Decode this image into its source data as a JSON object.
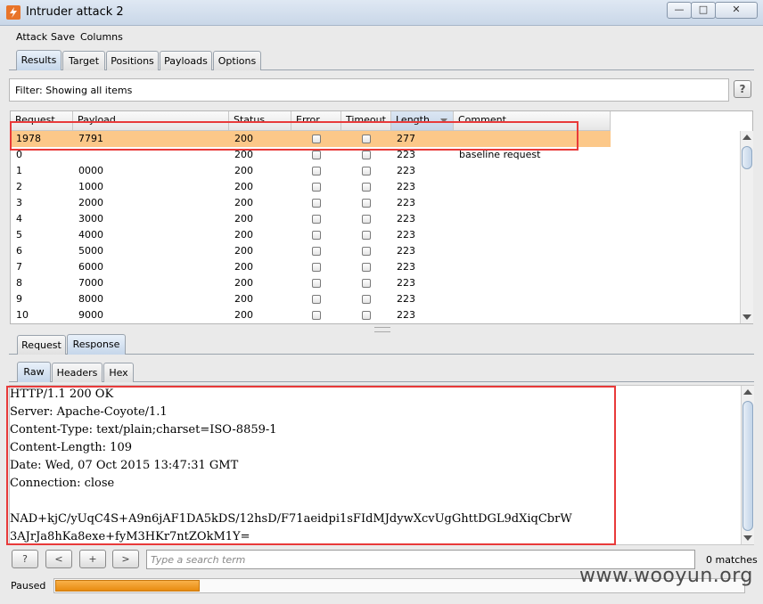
{
  "window": {
    "title": "Intruder attack 2",
    "min_label": "—",
    "max_label": "□",
    "close_label": "✕"
  },
  "menu": [
    "Attack",
    "Save",
    "Columns"
  ],
  "tabs": [
    "Results",
    "Target",
    "Positions",
    "Payloads",
    "Options"
  ],
  "active_tab": "Results",
  "filter": {
    "text": "Filter:  Showing all items",
    "help_label": "?"
  },
  "table": {
    "columns": [
      "Request",
      "Payload",
      "Status",
      "Error",
      "Timeout",
      "Length",
      "Comment"
    ],
    "sorted_column": "Length",
    "rows": [
      {
        "request": "1978",
        "payload": "7791",
        "status": "200",
        "error": false,
        "timeout": false,
        "length": "277",
        "comment": "",
        "selected": true
      },
      {
        "request": "0",
        "payload": "",
        "status": "200",
        "error": false,
        "timeout": false,
        "length": "223",
        "comment": "baseline request"
      },
      {
        "request": "1",
        "payload": "0000",
        "status": "200",
        "error": false,
        "timeout": false,
        "length": "223",
        "comment": ""
      },
      {
        "request": "2",
        "payload": "1000",
        "status": "200",
        "error": false,
        "timeout": false,
        "length": "223",
        "comment": ""
      },
      {
        "request": "3",
        "payload": "2000",
        "status": "200",
        "error": false,
        "timeout": false,
        "length": "223",
        "comment": ""
      },
      {
        "request": "4",
        "payload": "3000",
        "status": "200",
        "error": false,
        "timeout": false,
        "length": "223",
        "comment": ""
      },
      {
        "request": "5",
        "payload": "4000",
        "status": "200",
        "error": false,
        "timeout": false,
        "length": "223",
        "comment": ""
      },
      {
        "request": "6",
        "payload": "5000",
        "status": "200",
        "error": false,
        "timeout": false,
        "length": "223",
        "comment": ""
      },
      {
        "request": "7",
        "payload": "6000",
        "status": "200",
        "error": false,
        "timeout": false,
        "length": "223",
        "comment": ""
      },
      {
        "request": "8",
        "payload": "7000",
        "status": "200",
        "error": false,
        "timeout": false,
        "length": "223",
        "comment": ""
      },
      {
        "request": "9",
        "payload": "8000",
        "status": "200",
        "error": false,
        "timeout": false,
        "length": "223",
        "comment": ""
      },
      {
        "request": "10",
        "payload": "9000",
        "status": "200",
        "error": false,
        "timeout": false,
        "length": "223",
        "comment": ""
      }
    ]
  },
  "message_tabs": [
    "Request",
    "Response"
  ],
  "active_message_tab": "Response",
  "view_tabs": [
    "Raw",
    "Headers",
    "Hex"
  ],
  "active_view_tab": "Raw",
  "response_lines": [
    "HTTP/1.1 200 OK",
    "Server: Apache-Coyote/1.1",
    "Content-Type: text/plain;charset=ISO-8859-1",
    "Content-Length: 109",
    "Date: Wed, 07 Oct 2015 13:47:31 GMT",
    "Connection: close",
    "",
    "NAD+kjC/yUqC4S+A9n6jAF1DA5kDS/12hsD/F71aeidpi1sFIdMJdywXcvUgGhttDGL9dXiqCbrW",
    "3AJrJa8hKa8exe+fyM3HKr7ntZOkM1Y="
  ],
  "search": {
    "help_label": "?",
    "prev_label": "<",
    "add_label": "+",
    "next_label": ">",
    "placeholder": "Type a search term",
    "matches": "0 matches"
  },
  "status": {
    "label": "Paused",
    "progress_fraction": 0.21
  },
  "watermark": "www.wooyun.org"
}
